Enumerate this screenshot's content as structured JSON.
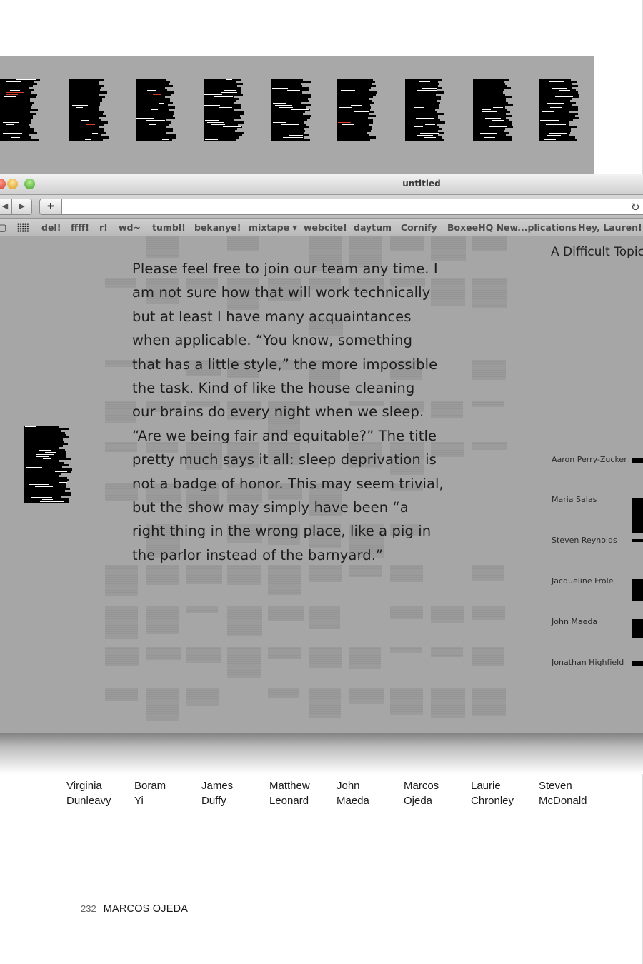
{
  "window": {
    "title": "untitled",
    "url": ""
  },
  "toolbar": {
    "back_icon": "◀",
    "forward_icon": "▶",
    "add_icon": "+",
    "reload_icon": "↻"
  },
  "bookmarks": [
    "del!",
    "ffff!",
    "r!",
    "wd~",
    "tumbl!",
    "bekanye!",
    "mixtape ▾",
    "webcite!",
    "daytum",
    "Cornify",
    "BoxeeHQ New...plications",
    "Hey, Lauren!..."
  ],
  "article": {
    "lines": [
      "Please feel free to join our team any time. I",
      "am not sure how that will work technically",
      "but at least I have many acquaintances",
      "when applicable. “You know, something",
      "that has a little style,” the more impossible",
      "the task. Kind of like the house cleaning",
      "our brains do every night when we sleep.",
      "“Are we being fair and equitable?” The title",
      "pretty much says it all: sleep deprivation is",
      "not a badge of honor. This may seem trivial,",
      "but the show may simply have been “a",
      "right thing in the wrong place, like a pig in",
      "the parlor instead of the barnyard.”"
    ]
  },
  "sidebar": {
    "title": "A Difficult Topic",
    "names": [
      "Aaron Perry-Zucker",
      "Maria Salas",
      "Steven Reynolds",
      "Jacqueline Frole",
      "John Maeda",
      "Jonathan Highfield"
    ]
  },
  "contributors": [
    {
      "first": "Virginia",
      "last": "Dunleavy"
    },
    {
      "first": "Boram",
      "last": "Yi"
    },
    {
      "first": "James",
      "last": "Duffy"
    },
    {
      "first": "Matthew",
      "last": "Leonard"
    },
    {
      "first": "John",
      "last": "Maeda"
    },
    {
      "first": "Marcos",
      "last": "Ojeda"
    },
    {
      "first": "Laurie",
      "last": "Chronley"
    },
    {
      "first": "Steven",
      "last": "McDonald"
    }
  ],
  "folio": {
    "page_number": "232",
    "author": "MARCOS OJEDA"
  }
}
